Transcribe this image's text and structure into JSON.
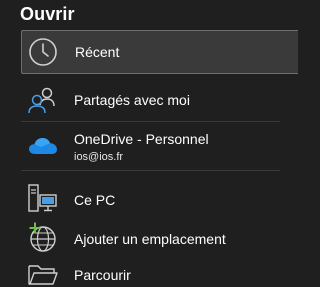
{
  "panel": {
    "title": "Ouvrir"
  },
  "locations": [
    {
      "label": "Récent",
      "icon": "clock-icon"
    },
    {
      "label": "Partagés avec moi",
      "icon": "shared-people-icon"
    },
    {
      "label": "OneDrive - Personnel",
      "account": "ios@ios.fr",
      "icon": "onedrive-cloud-icon"
    },
    {
      "label": "Ce PC",
      "icon": "computer-icon"
    },
    {
      "label": "Ajouter un emplacement",
      "icon": "add-location-globe-icon"
    },
    {
      "label": "Parcourir",
      "icon": "folder-icon"
    }
  ],
  "colors": {
    "background": "#1f1f1f",
    "selected_background": "#3a3a3a",
    "selected_border": "#6e6e6e",
    "accent_blue": "#4a9ee6",
    "onedrive_blue": "#1e88e5",
    "icon_gray": "#cfcfcf",
    "add_green": "#6abf4b"
  }
}
